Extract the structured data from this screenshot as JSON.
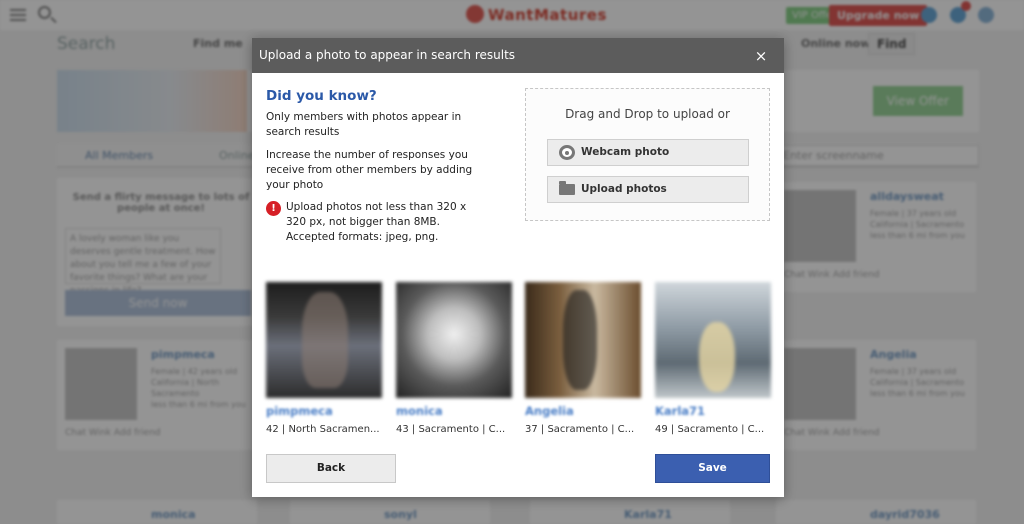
{
  "topbar": {
    "logo_text": "WantMatures",
    "vip_label": "VIP Offer",
    "upgrade_label": "Upgrade now",
    "notif_count": "1"
  },
  "background": {
    "search_title": "Search",
    "nav_links": [
      "Find me",
      "Online now"
    ],
    "find_button": "Find",
    "view_offer": "View Offer",
    "tabs": [
      "All Members",
      "Online"
    ],
    "screenname_placeholder": "Enter screenname",
    "flirt": {
      "title": "Send a flirty message to lots of people at once!",
      "text": "A lovely woman like you deserves gentle treatment. How about you tell me a few of your favorite things? What are your passions in life?",
      "send_label": "Send now"
    },
    "cards": [
      {
        "name": "pimpmeca",
        "info": "Female | 42 years old\nCalifornia | North Sacramento\nless than 6 mi from you",
        "actions": "Chat   Wink   Add friend"
      },
      {
        "name": "alldaysweat",
        "info": "Female | 37 years old\nCalifornia | Sacramento\nless than 6 mi from you",
        "actions": "Chat   Wink   Add friend"
      },
      {
        "name": "Angelia",
        "info": "Female | 37 years old\nCalifornia | Sacramento\nless than 6 mi from you",
        "actions": "Chat   Wink   Add friend"
      },
      {
        "name": "monica",
        "info": "",
        "actions": ""
      },
      {
        "name": "sonyl",
        "info": "",
        "actions": ""
      },
      {
        "name": "Karla71",
        "info": "",
        "actions": ""
      },
      {
        "name": "dayrid7036",
        "info": "",
        "actions": ""
      }
    ]
  },
  "modal": {
    "title": "Upload a photo to appear in search results",
    "close_symbol": "×",
    "did_you_know": "Did you know?",
    "info_1": "Only members with photos appear in search results",
    "info_2": "Increase the number of responses you receive from other members by adding your photo",
    "warning_icon": "!",
    "warning_text": "Upload photos not less than 320 x 320 px, not bigger than 8MB. Accepted formats: jpeg, png.",
    "dropzone_label": "Drag and Drop to upload or",
    "webcam_label": "Webcam photo",
    "upload_label": "Upload photos",
    "members": [
      {
        "name": "pimpmeca",
        "meta": "42 | North Sacramen..."
      },
      {
        "name": "monica",
        "meta": "43 | Sacramento | C..."
      },
      {
        "name": "Angelia",
        "meta": "37 | Sacramento | C..."
      },
      {
        "name": "Karla71",
        "meta": "49 | Sacramento | C..."
      }
    ],
    "back_label": "Back",
    "save_label": "Save"
  },
  "colors": {
    "accent": "#2b59a8",
    "save_button": "#3b5fb0",
    "warning": "#d61f26",
    "header": "#5c5c5c"
  }
}
